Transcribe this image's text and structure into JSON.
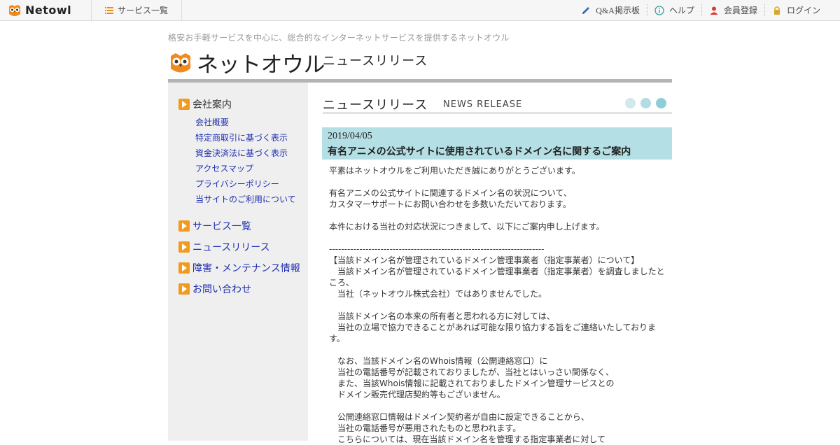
{
  "topbar": {
    "brand": "Netowl",
    "services": "サービス一覧",
    "links": {
      "qa": "Q&A掲示板",
      "help": "ヘルプ",
      "register": "会員登録",
      "login": "ログイン"
    }
  },
  "header": {
    "tagline": "格安お手軽サービスを中心に、総合的なインターネットサービスを提供するネットオウル",
    "logo_text": "ネットオウル",
    "page_title": "ニュースリリース"
  },
  "sidebar": {
    "company": "会社案内",
    "company_links": [
      "会社概要",
      "特定商取引に基づく表示",
      "資金決済法に基づく表示",
      "アクセスマップ",
      "プライバシーポリシー",
      "当サイトのご利用について"
    ],
    "services": "サービス一覧",
    "news": "ニュースリリース",
    "maintenance": "障害・メンテナンス情報",
    "contact": "お問い合わせ"
  },
  "main": {
    "title": "ニュースリリース",
    "title_en": "NEWS RELEASE",
    "news": {
      "date": "2019/04/05",
      "headline": "有名アニメの公式サイトに使用されているドメイン名に関するご案内",
      "body": [
        "平素はネットオウルをご利用いただき誠にありがとうございます。",
        "",
        "有名アニメの公式サイトに関連するドメイン名の状況について、",
        "カスタマーサポートにお問い合わせを多数いただいております。",
        "",
        "本件における当社の対応状況につきまして、以下にご案内申し上げます。",
        "",
        "-----------------------------------------------------------------------",
        "【当該ドメイン名が管理されているドメイン管理事業者（指定事業者）について】",
        "　当該ドメイン名が管理されているドメイン管理事業者（指定事業者）を調査しましたところ、",
        "　当社（ネットオウル株式会社）ではありませんでした。",
        "",
        "　当該ドメイン名の本来の所有者と思われる方に対しては、",
        "　当社の立場で協力できることがあれば可能な限り協力する旨をご連絡いたしております。",
        "",
        "　なお、当該ドメイン名のWhois情報（公開連絡窓口）に",
        "　当社の電話番号が記載されておりましたが、当社とはいっさい関係なく、",
        "　また、当該Whois情報に記載されておりましたドメイン管理サービスとの",
        "　ドメイン販売代理店契約等もございません。",
        "",
        "　公開連絡窓口情報はドメイン契約者が自由に設定できることから、",
        "　当社の電話番号が悪用されたものと思われます。",
        "　こちらについては、現在当該ドメイン名を管理する指定事業者に対して"
      ]
    }
  },
  "colors": {
    "accent_orange": "#f39a1c",
    "link_blue": "#1f2fb0",
    "news_header_bg": "#b4dfe4"
  }
}
